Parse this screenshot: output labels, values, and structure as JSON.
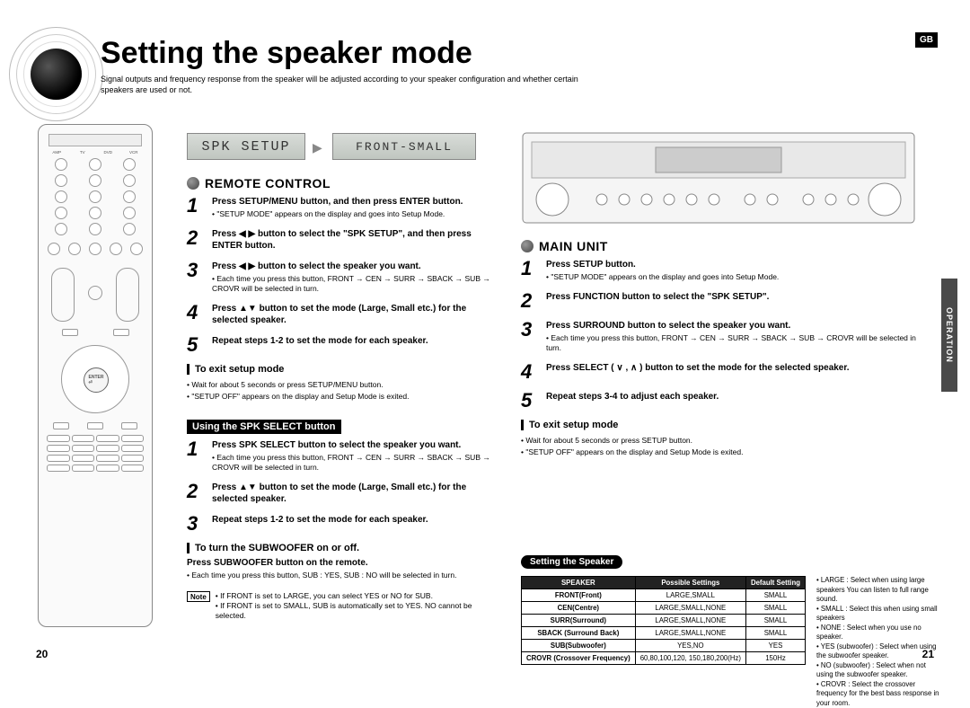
{
  "locale_tag": "GB",
  "side_tab": "OPERATION",
  "title": "Setting the speaker mode",
  "subtitle": "Signal outputs and frequency response from the speaker will be adjusted according to your speaker configuration and whether certain speakers are used or not.",
  "lcd1": "SPK SETUP",
  "lcd2": "FRONT-SMALL",
  "remote": {
    "heading": "REMOTE CONTROL",
    "steps": [
      {
        "n": "1",
        "lead": "Press SETUP/MENU button, and then press ENTER button.",
        "sub": "\"SETUP MODE\" appears on the display and goes into Setup Mode."
      },
      {
        "n": "2",
        "lead": "Press ◀ ▶ button to select the \"SPK SETUP\", and then press ENTER button.",
        "sub": ""
      },
      {
        "n": "3",
        "lead": "Press ◀ ▶ button to select the speaker you want.",
        "sub": "Each time you press this button, FRONT → CEN → SURR → SBACK → SUB → CROVR will be selected in turn."
      },
      {
        "n": "4",
        "lead": "Press ▲▼ button to set the mode (Large, Small etc.) for the selected speaker.",
        "sub": ""
      },
      {
        "n": "5",
        "lead": "Repeat steps 1-2 to set the mode for each speaker.",
        "sub": ""
      }
    ],
    "exit_h": "To exit setup mode",
    "exit_b1": "Wait for about 5 seconds or press SETUP/MENU button.",
    "exit_b2": "\"SETUP OFF\" appears on the display and Setup Mode is exited.",
    "spk_h": "Using the SPK SELECT button",
    "spk_steps": [
      {
        "n": "1",
        "lead": "Press SPK SELECT button to select the speaker you want.",
        "sub": "Each time you press this button, FRONT → CEN → SURR → SBACK → SUB → CROVR will be selected in turn."
      },
      {
        "n": "2",
        "lead": "Press ▲▼ button to set the mode (Large, Small etc.) for the selected speaker.",
        "sub": ""
      },
      {
        "n": "3",
        "lead": "Repeat steps 1-2 to set the mode for each speaker.",
        "sub": ""
      }
    ],
    "sub_h": "To turn the SUBWOOFER on or off.",
    "sub_lead": "Press SUBWOOFER button on the remote.",
    "sub_sub": "Each time you press this button, SUB : YES, SUB : NO will be selected in turn.",
    "note_label": "Note",
    "note1": "If FRONT is set to LARGE, you can select YES or NO for SUB.",
    "note2": "If FRONT is set to SMALL, SUB is automatically set to YES. NO cannot be selected."
  },
  "main": {
    "heading": "MAIN UNIT",
    "steps": [
      {
        "n": "1",
        "lead": "Press SETUP button.",
        "sub": "\"SETUP MODE\" appears on the display and goes into Setup Mode."
      },
      {
        "n": "2",
        "lead": "Press FUNCTION button to select the \"SPK SETUP\".",
        "sub": ""
      },
      {
        "n": "3",
        "lead": "Press SURROUND button to select the speaker you want.",
        "sub": "Each time you press this button, FRONT → CEN → SURR → SBACK → SUB → CROVR will be selected in turn."
      },
      {
        "n": "4",
        "lead": "Press SELECT ( ∨ , ∧ ) button to set the mode for the selected speaker.",
        "sub": ""
      },
      {
        "n": "5",
        "lead": "Repeat steps 3-4 to adjust each speaker.",
        "sub": ""
      }
    ],
    "exit_h": "To exit setup mode",
    "exit_b1": "Wait for about 5 seconds or press SETUP button.",
    "exit_b2": "\"SETUP OFF\" appears on the display and Setup Mode is exited."
  },
  "table_h": "Setting the Speaker",
  "table": {
    "headers": [
      "SPEAKER",
      "Possible Settings",
      "Default Setting"
    ],
    "rows": [
      [
        "FRONT(Front)",
        "LARGE,SMALL",
        "SMALL"
      ],
      [
        "CEN(Centre)",
        "LARGE,SMALL,NONE",
        "SMALL"
      ],
      [
        "SURR(Surround)",
        "LARGE,SMALL,NONE",
        "SMALL"
      ],
      [
        "SBACK (Surround Back)",
        "LARGE,SMALL,NONE",
        "SMALL"
      ],
      [
        "SUB(Subwoofer)",
        "YES,NO",
        "YES"
      ],
      [
        "CROVR (Crossover Frequency)",
        "60,80,100,120, 150,180,200(Hz)",
        "150Hz"
      ]
    ]
  },
  "defs": [
    "LARGE : Select when using large speakers You can listen to full range sound.",
    "SMALL : Select this when using small speakers",
    "NONE : Select when you use no speaker.",
    "YES (subwoofer) : Select when using the subwoofer speaker.",
    "NO (subwoofer) : Select when not using the subwoofer speaker.",
    "CROVR : Select the crossover frequency for the best bass response in your room."
  ],
  "page_left": "20",
  "page_right": "21"
}
